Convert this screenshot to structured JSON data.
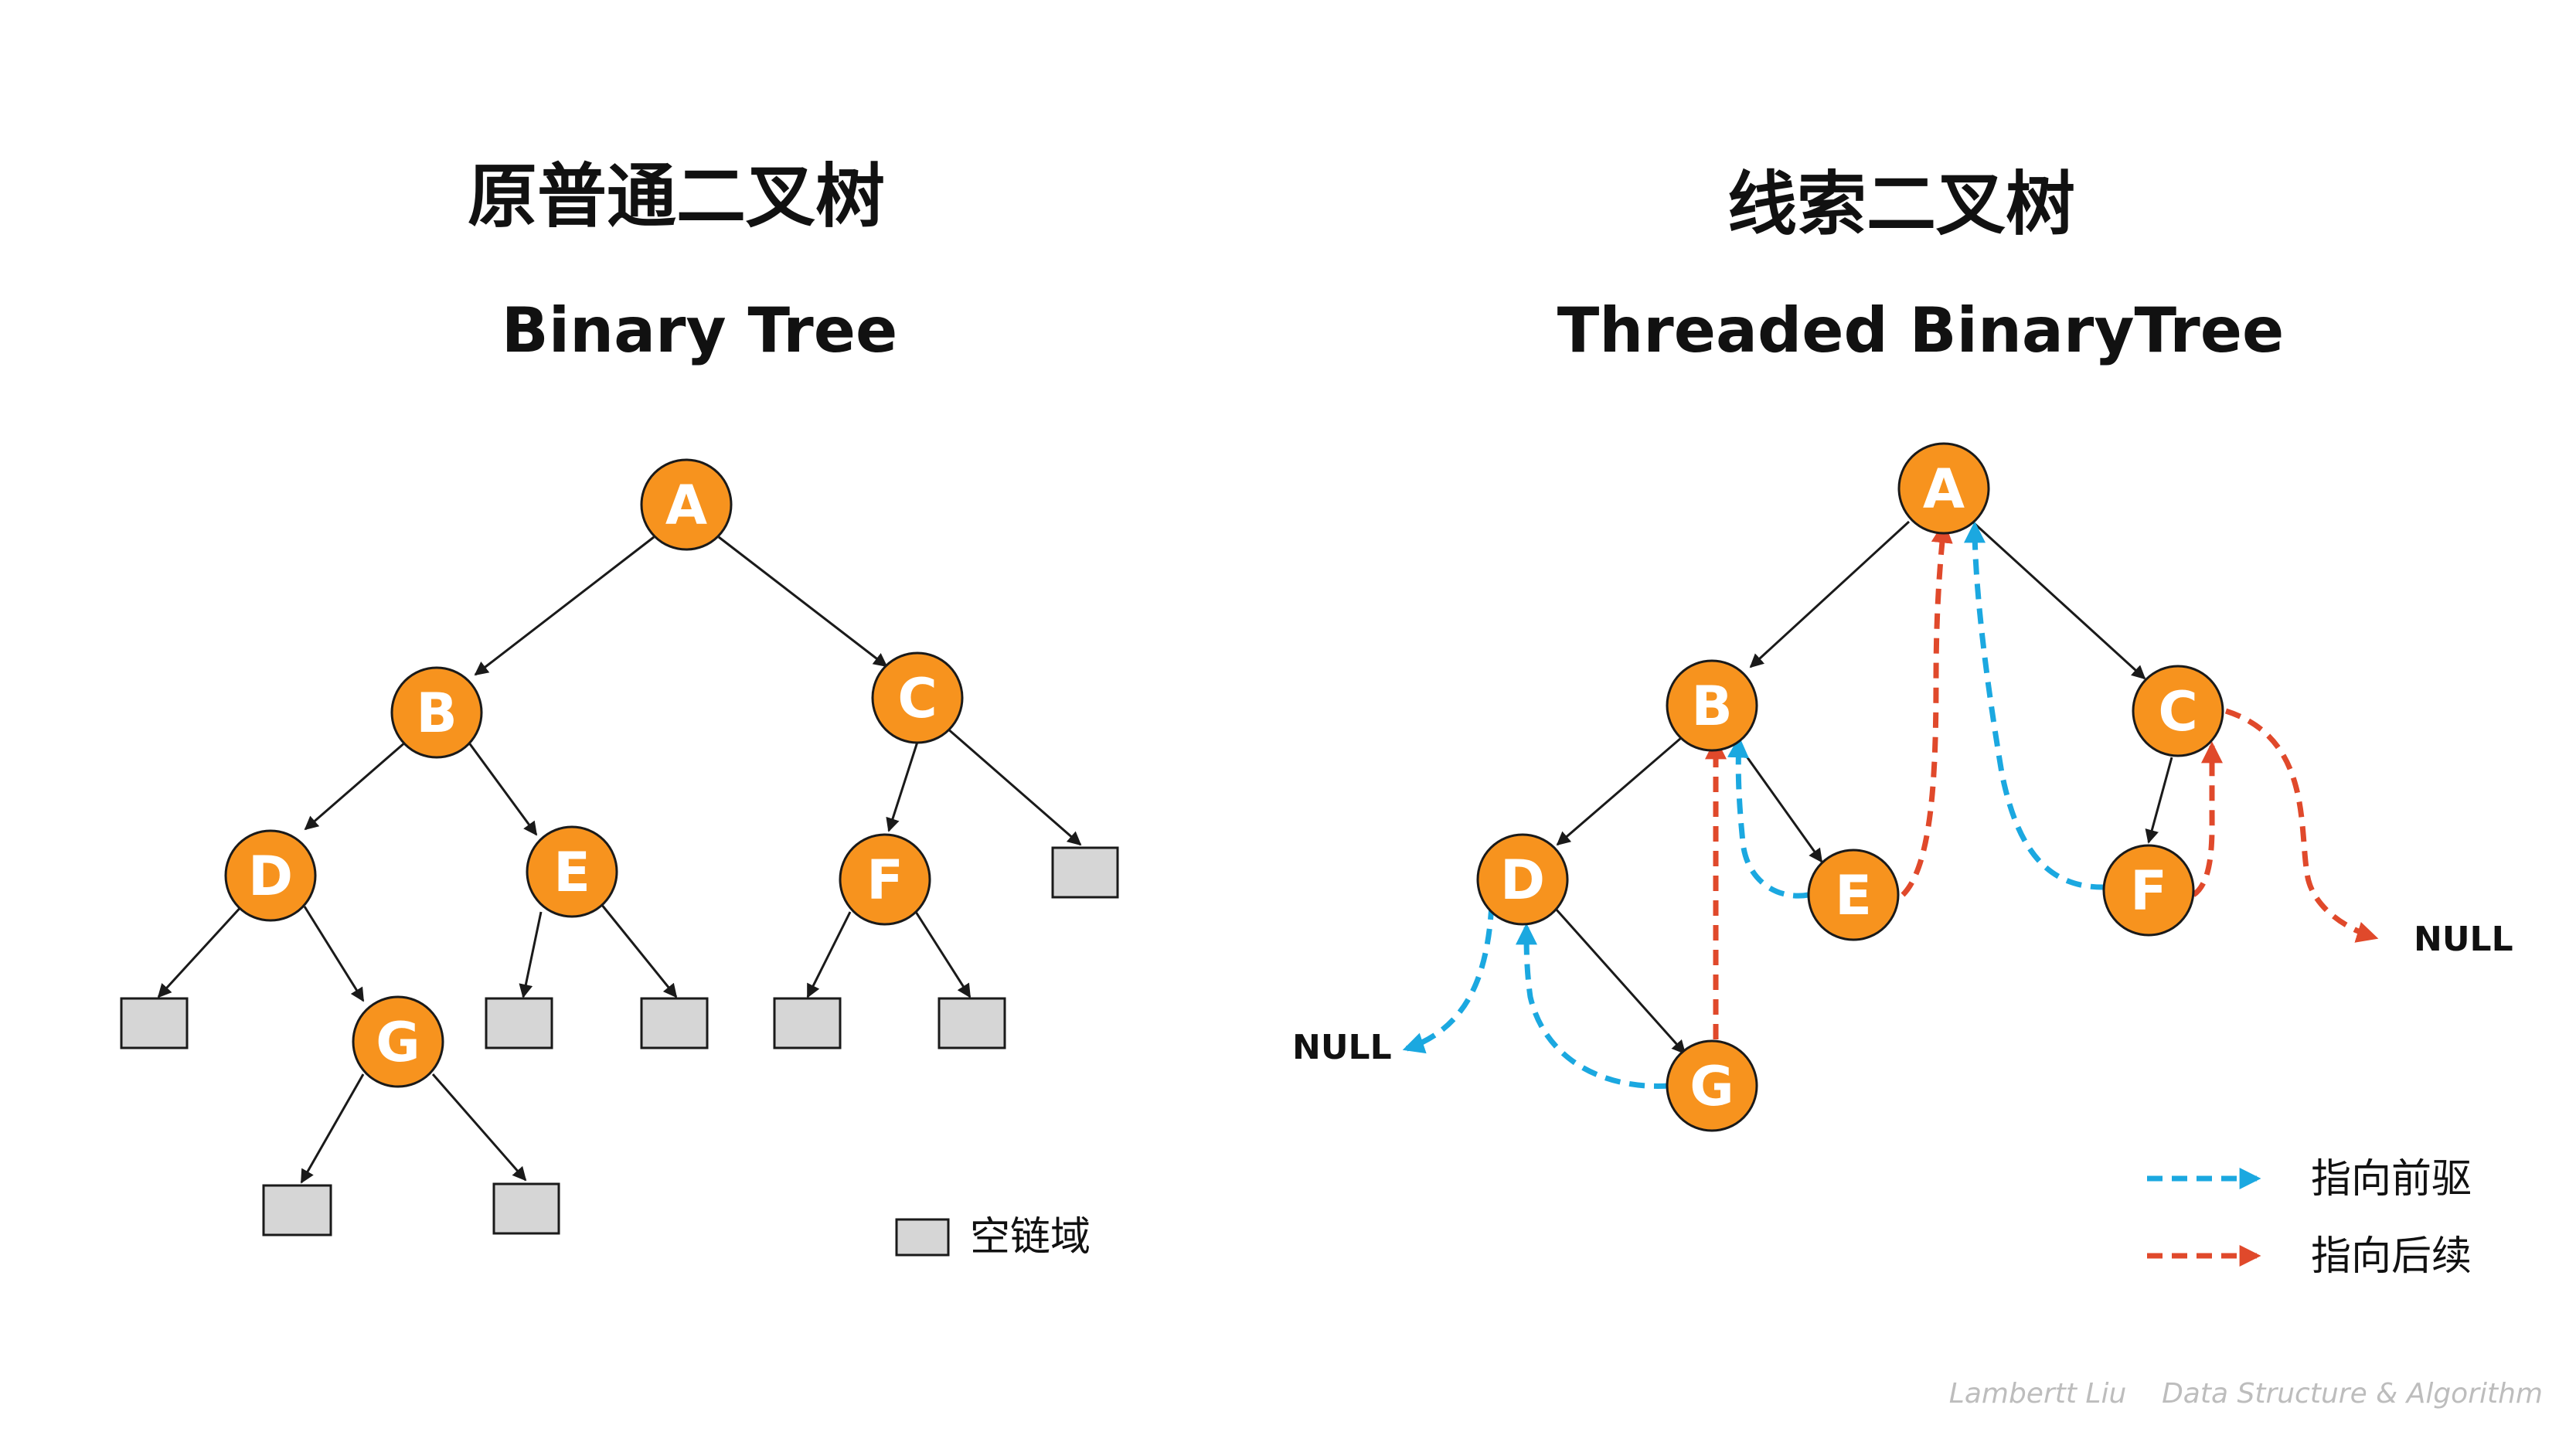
{
  "colors": {
    "node_fill": "#f7931e",
    "node_stroke": "#1a1a1a",
    "null_box_fill": "#d6d6d6",
    "predecessor": "#1ba8e0",
    "successor": "#e0492b",
    "edge": "#1a1a1a"
  },
  "left": {
    "title_cn": "原普通二叉树",
    "title_en": "Binary Tree",
    "nodes": [
      "A",
      "B",
      "C",
      "D",
      "E",
      "F",
      "G"
    ],
    "legend_label": "空链域"
  },
  "right": {
    "title_cn": "线索二叉树",
    "title_en": "Threaded BinaryTree",
    "nodes": [
      "A",
      "B",
      "C",
      "D",
      "E",
      "F",
      "G"
    ],
    "null_left": "NULL",
    "null_right": "NULL",
    "legend_predecessor": "指向前驱",
    "legend_successor": "指向后续"
  },
  "watermark": "Lambertt Liu    Data Structure & Algorithm"
}
